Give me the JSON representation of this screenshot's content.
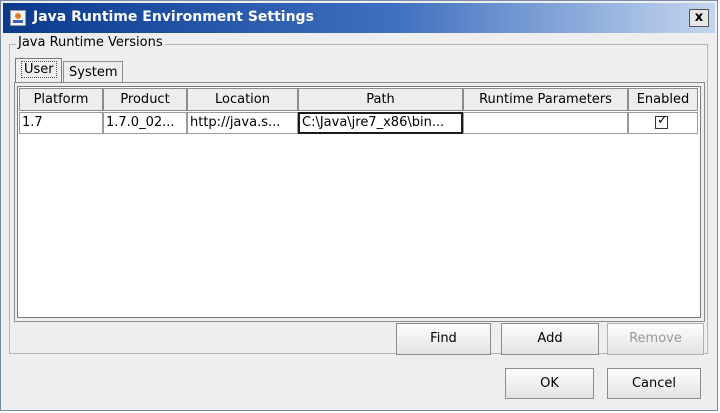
{
  "window": {
    "title": "Java Runtime Environment Settings",
    "close_label": "x"
  },
  "group": {
    "label": "Java Runtime Versions"
  },
  "tabs": [
    {
      "label": "User",
      "active": true
    },
    {
      "label": "System",
      "active": false
    }
  ],
  "table": {
    "columns": [
      "Platform",
      "Product",
      "Location",
      "Path",
      "Runtime Parameters",
      "Enabled"
    ],
    "rows": [
      {
        "platform": "1.7",
        "product": "1.7.0_02...",
        "location": "http://java.s...",
        "path": "C:\\Java\\jre7_x86\\bin...",
        "runtime_parameters": "",
        "enabled": true,
        "enabled_mark": "✓"
      }
    ]
  },
  "buttons": {
    "find": "Find",
    "add": "Add",
    "remove": "Remove",
    "ok": "OK",
    "cancel": "Cancel"
  }
}
